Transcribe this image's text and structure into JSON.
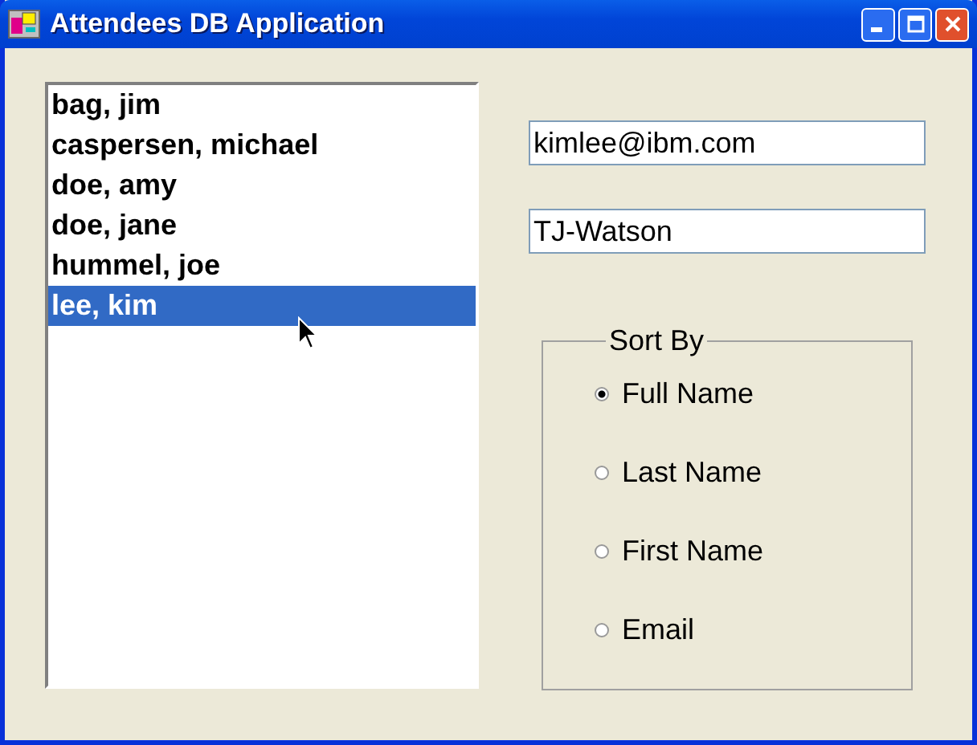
{
  "window": {
    "title": "Attendees DB Application"
  },
  "attendees": [
    {
      "name": "bag, jim",
      "selected": false
    },
    {
      "name": "caspersen, michael",
      "selected": false
    },
    {
      "name": "doe, amy",
      "selected": false
    },
    {
      "name": "doe, jane",
      "selected": false
    },
    {
      "name": "hummel, joe",
      "selected": false
    },
    {
      "name": "lee, kim",
      "selected": true
    }
  ],
  "email_field": {
    "value": "kimlee@ibm.com"
  },
  "location_field": {
    "value": "TJ-Watson"
  },
  "sort_by": {
    "label": "Sort By",
    "options": [
      {
        "label": "Full Name",
        "selected": true
      },
      {
        "label": "Last Name",
        "selected": false
      },
      {
        "label": "First Name",
        "selected": false
      },
      {
        "label": "Email",
        "selected": false
      }
    ]
  }
}
